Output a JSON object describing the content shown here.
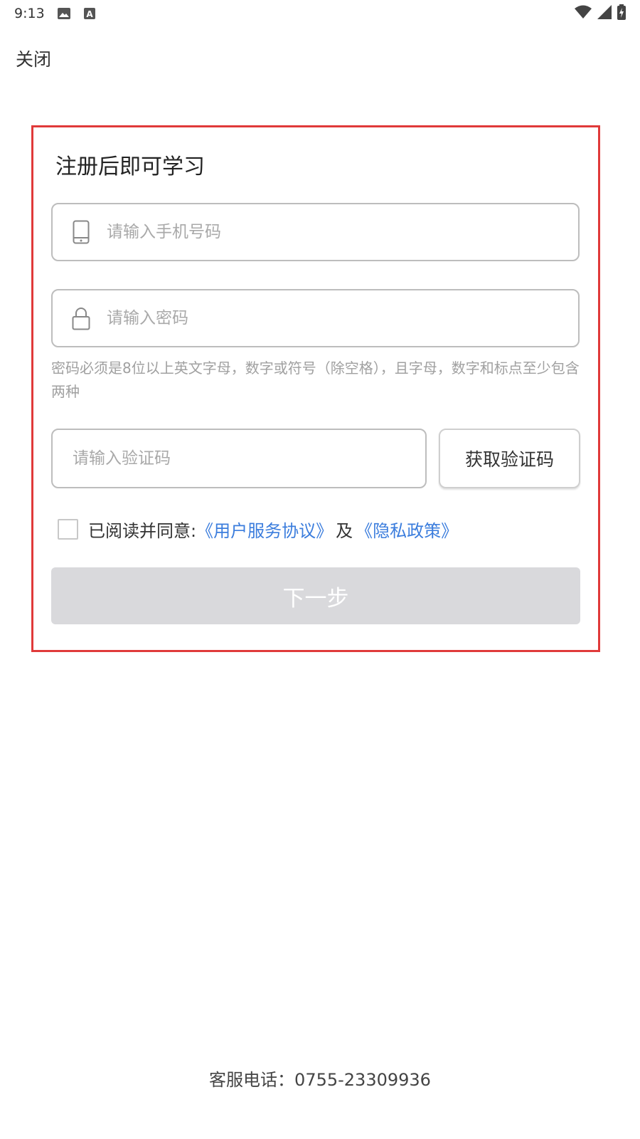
{
  "status_bar": {
    "time": "9:13",
    "left_icons": [
      "image-icon",
      "a-icon"
    ],
    "right_icons": [
      "wifi-icon",
      "signal-icon",
      "battery-charging-icon"
    ]
  },
  "header": {
    "close_label": "关闭"
  },
  "card": {
    "title": "注册后即可学习",
    "phone": {
      "icon": "phone-icon",
      "value": "",
      "placeholder": "请输入手机号码"
    },
    "password": {
      "icon": "lock-icon",
      "value": "",
      "placeholder": "请输入密码"
    },
    "password_hint": "密码必须是8位以上英文字母，数字或符号（除空格），且字母，数字和标点至少包含两种",
    "code": {
      "value": "",
      "placeholder": "请输入验证码"
    },
    "get_code_label": "获取验证码",
    "agreement": {
      "prefix": "已阅读并同意:",
      "user_agreement": "《用户服务协议》",
      "and": "及",
      "privacy_policy": "《隐私政策》",
      "checked": false
    },
    "next_label": "下一步"
  },
  "footer": {
    "service_phone": "客服电话：0755-23309936"
  },
  "colors": {
    "accent_link": "#3b7ddd",
    "highlight_border": "#e03a3a",
    "disabled_button": "#d9d9dc"
  }
}
